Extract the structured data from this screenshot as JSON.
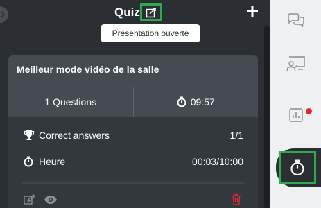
{
  "header": {
    "title": "Quiz",
    "tooltip": "Présentation ouverte"
  },
  "card": {
    "title": "Meilleur mode vidéo de la salle",
    "questions": "1 Questions",
    "timer": "09:57",
    "rows": [
      {
        "label": "Correct answers",
        "value": "1/1",
        "icon": "trophy-icon"
      },
      {
        "label": "Heure",
        "value": "00:03/10:00",
        "icon": "stopwatch-icon"
      }
    ]
  },
  "sidebar": {
    "items": [
      {
        "icon": "chat-icon",
        "active": false
      },
      {
        "icon": "presenter-icon",
        "active": false
      },
      {
        "icon": "poll-chart-icon",
        "active": false,
        "badge": true
      },
      {
        "icon": "stopwatch-icon",
        "active": true
      }
    ]
  },
  "colors": {
    "background": "#2b2f33",
    "card": "#33383d",
    "card_header": "#454b51",
    "highlight": "#2da94f",
    "delete": "#e0282e",
    "sidebar": "#eef0f2"
  }
}
